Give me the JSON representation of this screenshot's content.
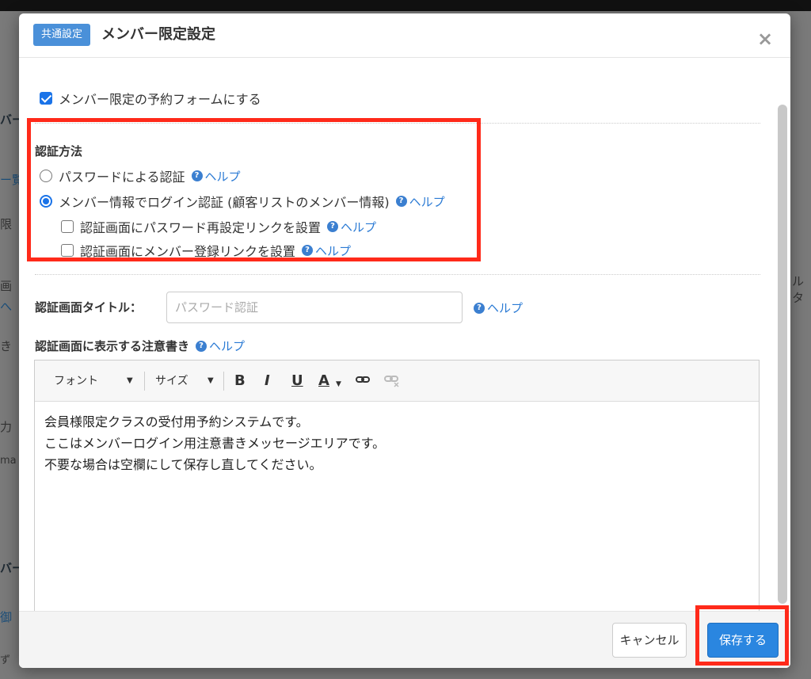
{
  "background": {
    "fragments": [
      "バー",
      "ー覧",
      "限",
      "画",
      "へ",
      "き",
      "力",
      "ma",
      "バー",
      "御",
      "ず",
      "ルタ"
    ]
  },
  "modal": {
    "badge": "共通設定",
    "title": "メンバー限定設定",
    "close_symbol": "×",
    "member_only_checkbox": {
      "label": "メンバー限定の予約フォームにする",
      "checked": true
    },
    "auth": {
      "heading": "認証方法",
      "help_symbol": "?",
      "help_label": "ヘルプ",
      "options": [
        {
          "label": "パスワードによる認証",
          "checked": false
        },
        {
          "label": "メンバー情報でログイン認証 (顧客リストのメンバー情報)",
          "checked": true
        }
      ],
      "sub_options": [
        {
          "label": "認証画面にパスワード再設定リンクを設置",
          "checked": false
        },
        {
          "label": "認証画面にメンバー登録リンクを設置",
          "checked": false
        }
      ]
    },
    "title_field": {
      "label": "認証画面タイトル：",
      "placeholder": "パスワード認証"
    },
    "notes": {
      "label": "認証画面に表示する注意書き",
      "toolbar": {
        "font": "フォント",
        "size": "サイズ",
        "bold": "B",
        "italic": "I",
        "underline": "U",
        "color": "A"
      },
      "content": [
        "会員様限定クラスの受付用予約システムです。",
        "ここはメンバーログイン用注意書きメッセージエリアです。",
        "不要な場合は空欄にして保存し直してください。"
      ]
    },
    "footer": {
      "cancel": "キャンセル",
      "save": "保存する"
    }
  },
  "colors": {
    "accent": "#2a86e0",
    "highlight": "#ff2a1a",
    "help": "#2a7ad4"
  }
}
